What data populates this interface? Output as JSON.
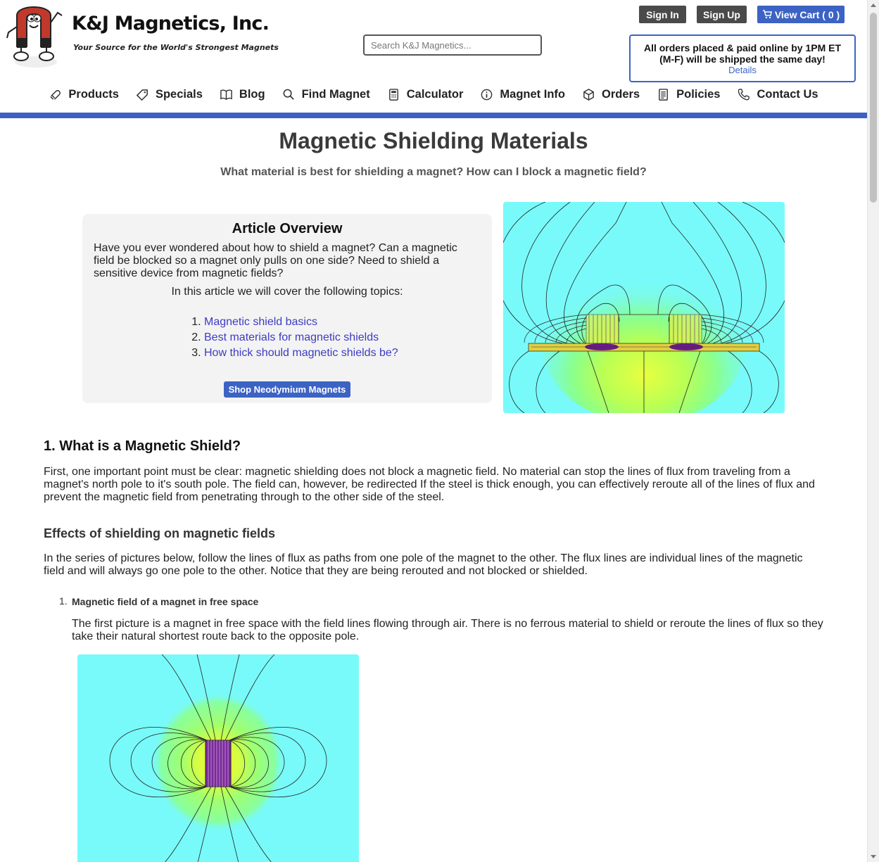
{
  "header": {
    "brand": "K&J Magnetics, Inc.",
    "tagline": "Your Source for the World's Strongest Magnets",
    "search_placeholder": "Search K&J Magnetics...",
    "sign_in": "Sign In",
    "sign_up": "Sign Up",
    "cart": "View Cart ( 0 )",
    "shipping_line1": "All orders placed & paid online by 1PM ET",
    "shipping_line2": "(M-F) will be shipped the same day!",
    "shipping_details": "Details"
  },
  "nav": [
    {
      "label": "Products",
      "icon": "magnet-icon"
    },
    {
      "label": "Specials",
      "icon": "tag-icon"
    },
    {
      "label": "Blog",
      "icon": "book-icon"
    },
    {
      "label": "Find Magnet",
      "icon": "search-icon"
    },
    {
      "label": "Calculator",
      "icon": "calculator-icon"
    },
    {
      "label": "Magnet Info",
      "icon": "info-icon"
    },
    {
      "label": "Orders",
      "icon": "box-icon"
    },
    {
      "label": "Policies",
      "icon": "document-icon"
    },
    {
      "label": "Contact Us",
      "icon": "phone-icon"
    }
  ],
  "article": {
    "title": "Magnetic Shielding Materials",
    "subtitle": "What material is best for shielding a magnet? How can I block a magnetic field?",
    "overview": {
      "heading": "Article Overview",
      "intro": "Have you ever wondered about how to shield a magnet? Can a magnetic field be blocked so a magnet only pulls on one side? Need to shield a sensitive device from magnetic fields?",
      "cover": "In this article we will cover the following topics:",
      "topics": [
        "Magnetic shield basics",
        "Best materials for magnetic shields",
        "How thick should magnetic shields be?"
      ],
      "shop_button": "Shop Neodymium Magnets"
    },
    "section1": {
      "heading": "1. What is a Magnetic Shield?",
      "para": "First, one important point must be clear: magnetic shielding does not block a magnetic field. No material can stop the lines of flux from traveling from a magnet's north pole to it's south pole. The field can, however, be redirected If the steel is thick enough, you can effectively reroute all of the lines of flux and prevent the magnetic field from penetrating through to the other side of the steel."
    },
    "effects": {
      "heading": "Effects of shielding on magnetic fields",
      "para": "In the series of pictures below, follow the lines of flux as paths from one pole of the magnet to the other. The flux lines are individual lines of the magnetic field and will always go one pole to the other. Notice that they are being rerouted and not blocked or shielded."
    },
    "item1": {
      "number": "1.",
      "heading": "Magnetic field of a magnet in free space",
      "para": "The first picture is a magnet in free space with the field lines flowing through air. There is no ferrous material to shield or reroute the lines of flux so they take their natural shortest route back to the opposite pole."
    }
  },
  "colors": {
    "accent": "#3c63c4",
    "nav_bar": "#3c5fc4",
    "dark_button": "#4a4a4a",
    "field_background": "#78fafa"
  }
}
